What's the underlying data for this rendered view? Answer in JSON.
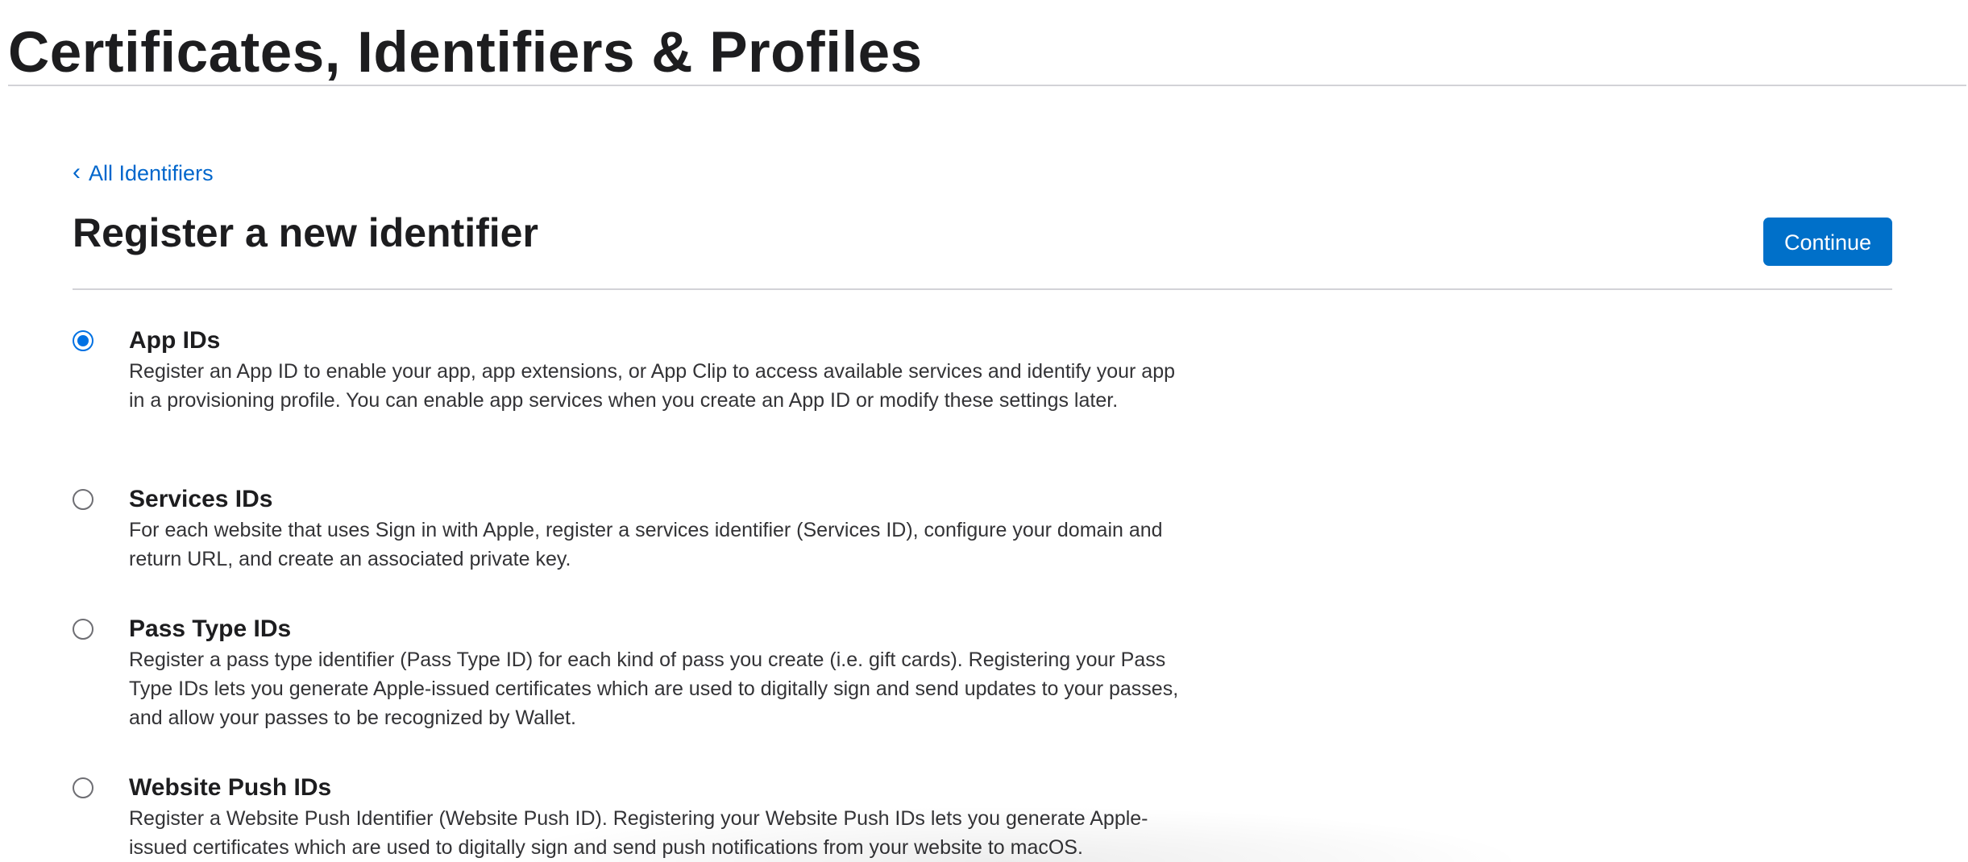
{
  "header": {
    "title": "Certificates, Identifiers & Profiles"
  },
  "breadcrumb": {
    "back_label": "All Identifiers",
    "back_icon": "chevron-left-icon"
  },
  "main": {
    "heading": "Register a new identifier",
    "continue_label": "Continue"
  },
  "colors": {
    "accent": "#0070c9",
    "link": "#0066cc",
    "text": "#1d1d1f",
    "divider": "#d2d2d7"
  },
  "options": [
    {
      "title": "App IDs",
      "description": "Register an App ID to enable your app, app extensions, or App Clip to access available services and identify your app in a provisioning profile. You can enable app services when you create an App ID or modify these settings later.",
      "selected": true
    },
    {
      "title": "Services IDs",
      "description": "For each website that uses Sign in with Apple, register a services identifier (Services ID), configure your domain and return URL, and create an associated private key.",
      "selected": false
    },
    {
      "title": "Pass Type IDs",
      "description": "Register a pass type identifier (Pass Type ID) for each kind of pass you create (i.e. gift cards). Registering your Pass Type IDs lets you generate Apple-issued certificates which are used to digitally sign and send updates to your passes, and allow your passes to be recognized by Wallet.",
      "selected": false
    },
    {
      "title": "Website Push IDs",
      "description": "Register a Website Push Identifier (Website Push ID). Registering your Website Push IDs lets you generate Apple-issued certificates which are used to digitally sign and send push notifications from your website to macOS.",
      "selected": false
    }
  ]
}
